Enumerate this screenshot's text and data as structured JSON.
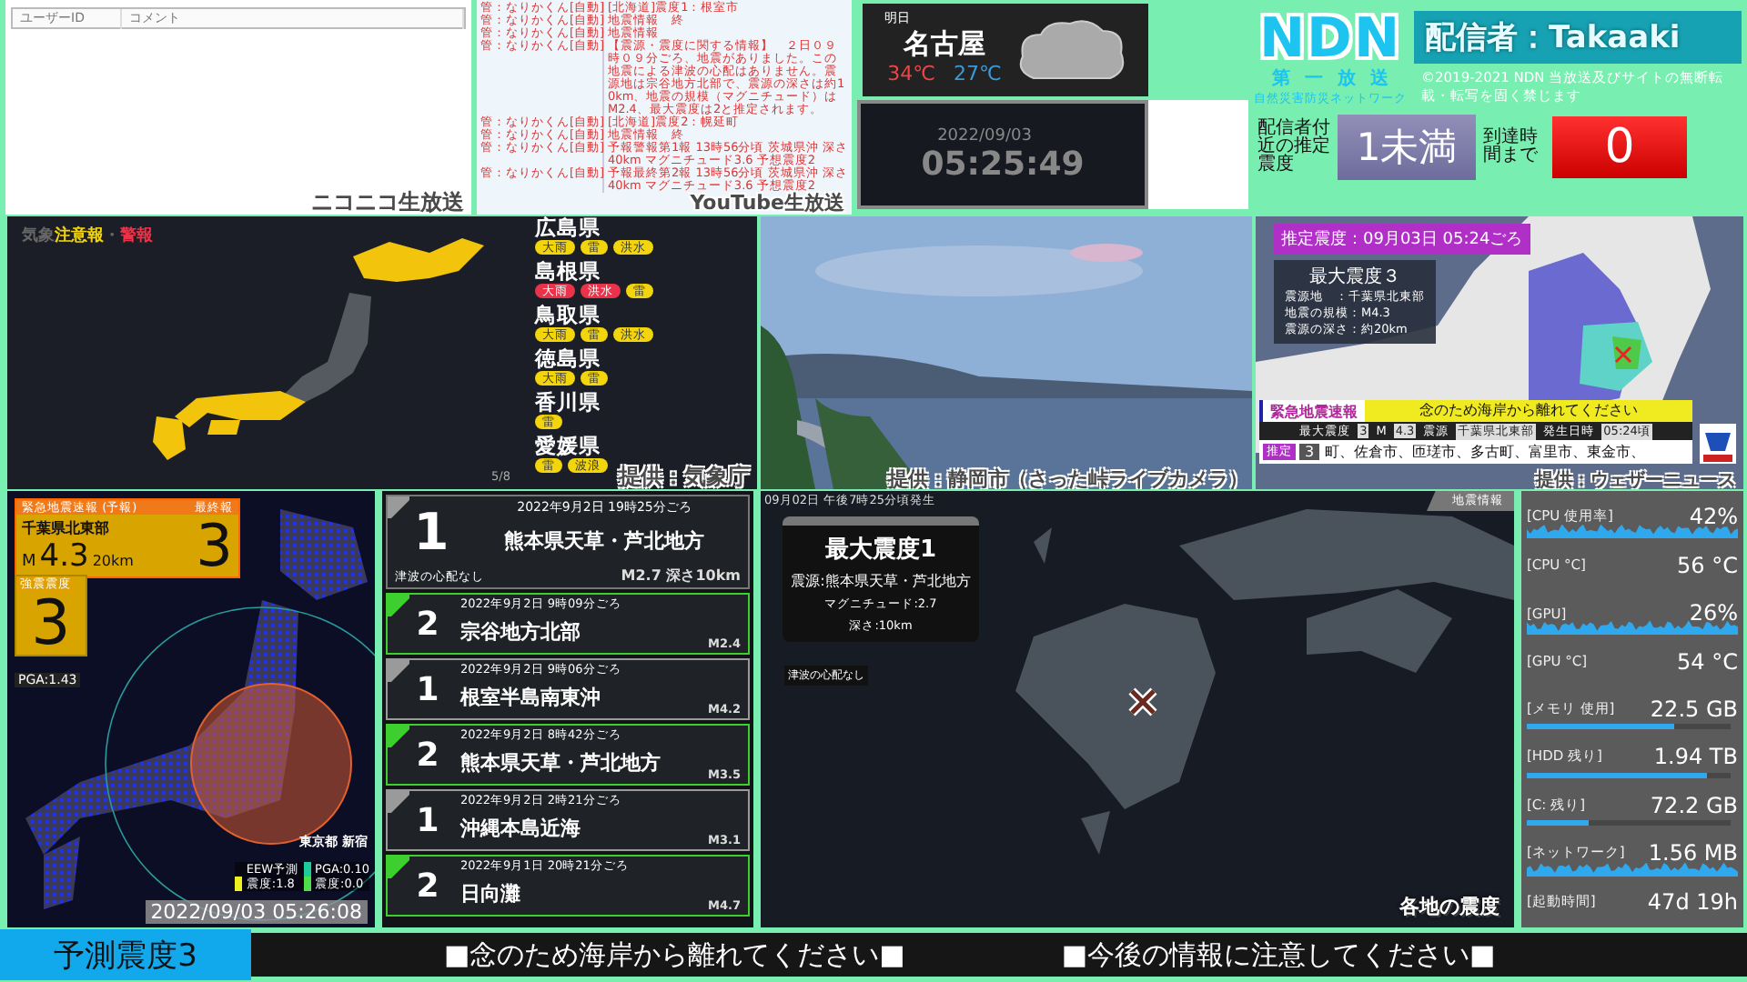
{
  "comments": {
    "columns": [
      "ユーザーID",
      "コメント"
    ],
    "caption": "ニコニコ生放送"
  },
  "youtube_chat": {
    "caption": "YouTube生放送",
    "messages": [
      {
        "user": "管：なりかくん[自動]",
        "text": "[北海道]震度1：根室市"
      },
      {
        "user": "管：なりかくん[自動]",
        "text": "地震情報　終"
      },
      {
        "user": "管：なりかくん[自動]",
        "text": "地震情報"
      },
      {
        "user": "管：なりかくん[自動]",
        "text": "【震源・震度に関する情報】　２日０９時０９分ごろ、地震がありました。この地震による津波の心配はありません。震源地は宗谷地方北部で、震源の深さは約10km、地震の規模（マグニチュード）は M2.4、最大震度は2と推定されます。"
      },
      {
        "user": "管：なりかくん[自動]",
        "text": "[北海道]震度2：幌延町"
      },
      {
        "user": "管：なりかくん[自動]",
        "text": "地震情報　終"
      },
      {
        "user": "管：なりかくん[自動]",
        "text": "予報警報第1報 13時56分頃 茨城県沖 深さ40km マグニチュード3.6 予想震度2"
      },
      {
        "user": "管：なりかくん[自動]",
        "text": "予報最終第2報 13時56分頃 茨城県沖 深さ40km マグニチュード3.6 予想震度2"
      }
    ]
  },
  "weather": {
    "day": "明日",
    "city": "名古屋",
    "high": "34℃",
    "low": "27℃"
  },
  "clock": {
    "date": "2022/09/03",
    "time": "05:25:49"
  },
  "station": {
    "logo": "NDN",
    "streamer": "配信者：Takaaki",
    "channel": "第一放送",
    "network": "自然災害防災ネットワーク",
    "copyright": "©2019-2021 NDN 当放送及びサイトの無断転載・転写を固く禁じます",
    "local_label": "配信者付近の推定震度",
    "local_intensity": "1未満",
    "arrival_label": "到達時間まで",
    "arrival": "0"
  },
  "warnings_map": {
    "title_prefix": "気象",
    "advisory": "注意報",
    "separator": "・",
    "warning": "警報",
    "page": "5/8",
    "caption": "提供：気象庁",
    "prefectures": [
      {
        "name": "広島県",
        "tags": [
          {
            "label": "大雨",
            "kind": "advisory"
          },
          {
            "label": "雷",
            "kind": "advisory"
          },
          {
            "label": "洪水",
            "kind": "advisory"
          }
        ]
      },
      {
        "name": "島根県",
        "tags": [
          {
            "label": "大雨",
            "kind": "warning"
          },
          {
            "label": "洪水",
            "kind": "warning"
          },
          {
            "label": "雷",
            "kind": "advisory"
          }
        ]
      },
      {
        "name": "鳥取県",
        "tags": [
          {
            "label": "大雨",
            "kind": "advisory"
          },
          {
            "label": "雷",
            "kind": "advisory"
          },
          {
            "label": "洪水",
            "kind": "advisory"
          }
        ]
      },
      {
        "name": "徳島県",
        "tags": [
          {
            "label": "大雨",
            "kind": "advisory"
          },
          {
            "label": "雷",
            "kind": "advisory"
          }
        ]
      },
      {
        "name": "香川県",
        "tags": [
          {
            "label": "雷",
            "kind": "advisory"
          }
        ]
      },
      {
        "name": "愛媛県",
        "tags": [
          {
            "label": "雷",
            "kind": "advisory"
          },
          {
            "label": "波浪",
            "kind": "advisory"
          }
        ]
      }
    ]
  },
  "live_camera": {
    "kind": "picture",
    "caption": "提供：静岡市（さった峠ライブカメラ）"
  },
  "eew_map": {
    "badge": "推定震度：09月03日 05:24ごろ",
    "max": "最大震度３",
    "details": [
      "震源地　：千葉県北東部",
      "地震の規模：M4.3",
      "震源の深さ：約20km"
    ],
    "alert_label": "緊急地震速報",
    "alert_message": "念のため海岸から離れてください",
    "info": [
      {
        "label": "最大震度",
        "value": "3"
      },
      {
        "label": "M",
        "value": "4.3"
      },
      {
        "label": "震源",
        "value": "千葉県北東部"
      },
      {
        "label": "発生日時",
        "value": "05:24頃"
      }
    ],
    "estimate_label": "推定",
    "estimate_value": "3",
    "areas": "町、佐倉市、匝瑳市、多古町、富里市、東金市、",
    "caption": "提供：ウェザーニュース"
  },
  "shindo": {
    "header": "緊急地震速報 (予報)",
    "final": "最終報",
    "region": "千葉県北東部",
    "magnitude_prefix": "M",
    "magnitude": "4.3",
    "depth": "20km",
    "intensity": "3",
    "observed_label": "強震震度",
    "observed": "3",
    "pga": "PGA:1.43",
    "location": "東京都 新宿",
    "eew_label": "EEW予測",
    "eew_intensity": "震度:1.8",
    "obs_pga": "PGA:0.10",
    "obs_intensity": "震度:0.0",
    "timestamp": "2022/09/03 05:26:08"
  },
  "quakes": [
    {
      "kind": "latest",
      "intensity": "1",
      "time": "2022年9月2日 19時25分ごろ",
      "place": "熊本県天草・芦北地方",
      "magnitude": "M2.7 深さ10km",
      "note": "津波の心配なし",
      "color": "#9a9a9a"
    },
    {
      "kind": "past",
      "intensity": "2",
      "time": "2022年9月2日 9時09分ごろ",
      "place": "宗谷地方北部",
      "magnitude": "M2.4",
      "color": "#3ccf2e"
    },
    {
      "kind": "past",
      "intensity": "1",
      "time": "2022年9月2日 9時06分ごろ",
      "place": "根室半島南東沖",
      "magnitude": "M4.2",
      "color": "#9a9a9a"
    },
    {
      "kind": "past",
      "intensity": "2",
      "time": "2022年9月2日 8時42分ごろ",
      "place": "熊本県天草・芦北地方",
      "magnitude": "M3.5",
      "color": "#3ccf2e"
    },
    {
      "kind": "past",
      "intensity": "1",
      "time": "2022年9月2日 2時21分ごろ",
      "place": "沖縄本島近海",
      "magnitude": "M3.1",
      "color": "#9a9a9a"
    },
    {
      "kind": "past",
      "intensity": "2",
      "time": "2022年9月1日 20時21分ごろ",
      "place": "日向灘",
      "magnitude": "M4.7",
      "color": "#3ccf2e"
    }
  ],
  "quake_map": {
    "occurred": "09月02日 午後7時25分頃発生",
    "tab": "地震情報",
    "max": "最大震度1",
    "details": [
      "震源:熊本県天草・芦北地方",
      "マグニチュード:2.7",
      "深さ:10km"
    ],
    "tsunami": "津波の心配なし",
    "logo": "各地の震度"
  },
  "stats": [
    {
      "label": "[CPU 使用率]",
      "value": "42%",
      "kind": "graph"
    },
    {
      "label": "[CPU °C]",
      "value": "56 °C",
      "kind": "plain"
    },
    {
      "label": "[GPU]",
      "value": "26%",
      "kind": "graph"
    },
    {
      "label": "[GPU °C]",
      "value": "54 °C",
      "kind": "plain"
    },
    {
      "label": "[メモリ 使用]",
      "value": "22.5 GB",
      "kind": "bar",
      "level": 0.72
    },
    {
      "label": "[HDD 残り]",
      "value": "1.94 TB",
      "kind": "bar",
      "level": 0.88
    },
    {
      "label": "[C: 残り]",
      "value": "72.2 GB",
      "kind": "bar",
      "level": 0.3
    },
    {
      "label": "[ネットワーク]",
      "value": "1.56 MB",
      "kind": "graph"
    },
    {
      "label": "[起動時間]",
      "value": "47d 19h",
      "kind": "plain"
    }
  ],
  "ticker": {
    "forecast": "予測震度3",
    "messages": [
      "■念のため海岸から離れてください■",
      "■今後の情報に注意してください■"
    ]
  }
}
